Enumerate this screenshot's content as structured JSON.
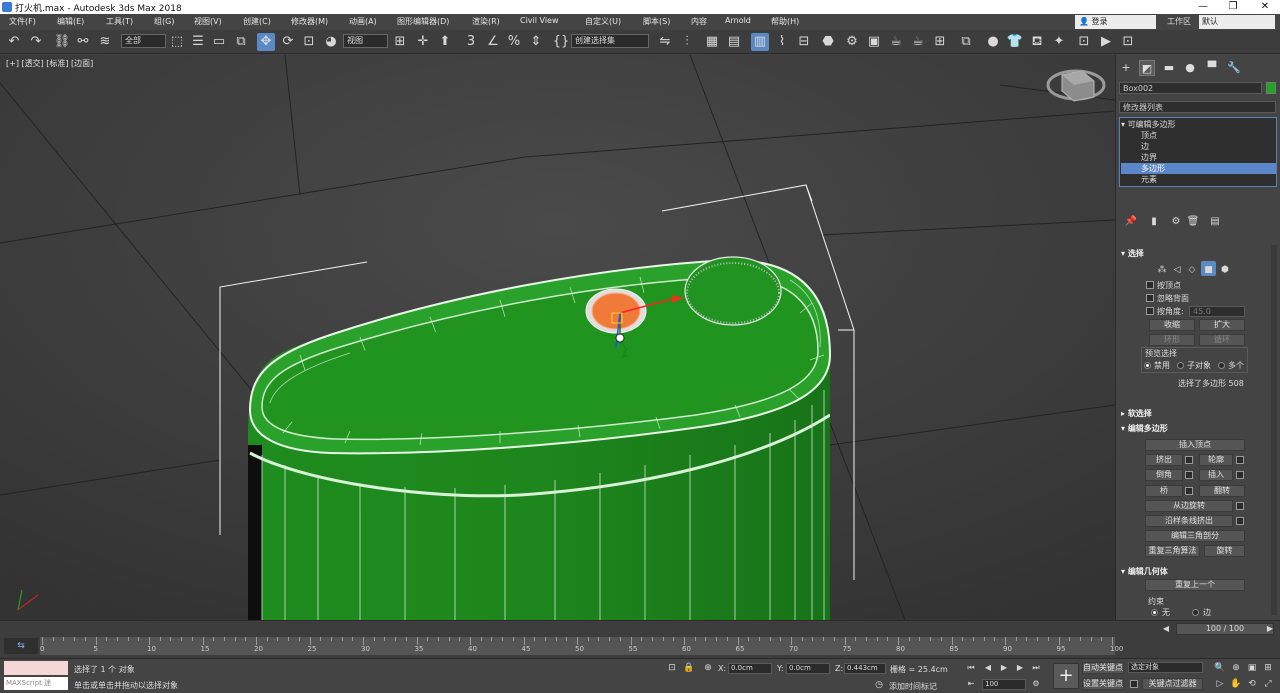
{
  "window": {
    "title": "打火机.max - Autodesk 3ds Max 2018",
    "min_glyph": "—",
    "max_glyph": "❐",
    "close_glyph": "✕"
  },
  "menubar": {
    "items": [
      "文件(F)",
      "编辑(E)",
      "工具(T)",
      "组(G)",
      "视图(V)",
      "创建(C)",
      "修改器(M)",
      "动画(A)",
      "图形编辑器(D)",
      "渲染(R)",
      "Civil View",
      "自定义(U)",
      "脚本(S)",
      "内容",
      "Arnold",
      "帮助(H)"
    ],
    "login": "登录",
    "workspace_label": "工作区",
    "workspace_value": "默认"
  },
  "toolbar": {
    "selection_filter": "全部",
    "ref_coord": "视图",
    "named_selection": "创建选择集"
  },
  "viewport": {
    "label": "[+] [透交] [标准] [边面]"
  },
  "command_panel": {
    "object_name": "Box002",
    "object_color": "#1fa51f",
    "modifier_list": "修改器列表",
    "stack": {
      "root": "可编辑多边形",
      "items": [
        "顶点",
        "边",
        "边界",
        "多边形",
        "元素"
      ],
      "selected": "多边形"
    },
    "selection": {
      "title": "选择",
      "by_vertex": "按顶点",
      "ignore_backfacing": "忽略背面",
      "by_angle": "按角度:",
      "angle_value": "45.0",
      "shrink": "收缩",
      "grow": "扩大",
      "ring": "环形",
      "loop": "循环",
      "preview_title": "预览选择",
      "preview_off": "禁用",
      "preview_subobj": "子对象",
      "preview_multi": "多个",
      "status": "选择了多边形 508"
    },
    "soft_selection": {
      "title": "软选择"
    },
    "edit_poly": {
      "title": "编辑多边形",
      "insert_vertex": "插入顶点",
      "extrude": "挤出",
      "outline": "轮廓",
      "bevel": "倒角",
      "inset": "插入",
      "bridge": "桥",
      "flip": "翻转",
      "hinge": "从边旋转",
      "extrude_along_spline": "沿样条线挤出",
      "edit_triangulation": "编辑三角剖分",
      "retriangulate": "重复三角算法",
      "turn": "旋转"
    },
    "edit_geometry": {
      "title": "编辑几何体",
      "repeat_last": "重复上一个",
      "constraints": "约束",
      "none": "无",
      "edge": "边"
    }
  },
  "timeline": {
    "frame_display": "100 / 100",
    "ticks": [
      "0",
      "5",
      "10",
      "15",
      "20",
      "25",
      "30",
      "35",
      "40",
      "45",
      "50",
      "55",
      "60",
      "65",
      "70",
      "75",
      "80",
      "85",
      "90",
      "95",
      "100"
    ]
  },
  "statusbar": {
    "maxscript": "MAXScript 迷",
    "selected": "选择了 1 个 对象",
    "prompt": "单击或单击并拖动以选择对象",
    "x_label": "X:",
    "x": "0.0cm",
    "y_label": "Y:",
    "y": "0.0cm",
    "z_label": "Z:",
    "z": "0.443cm",
    "grid": "栅格 = 25.4cm",
    "add_time_tag": "添加时间标记",
    "auto_key": "自动关键点",
    "selected_objects": "选定对象",
    "set_key": "设置关键点",
    "key_filters": "关键点过滤器",
    "frame": "100"
  }
}
